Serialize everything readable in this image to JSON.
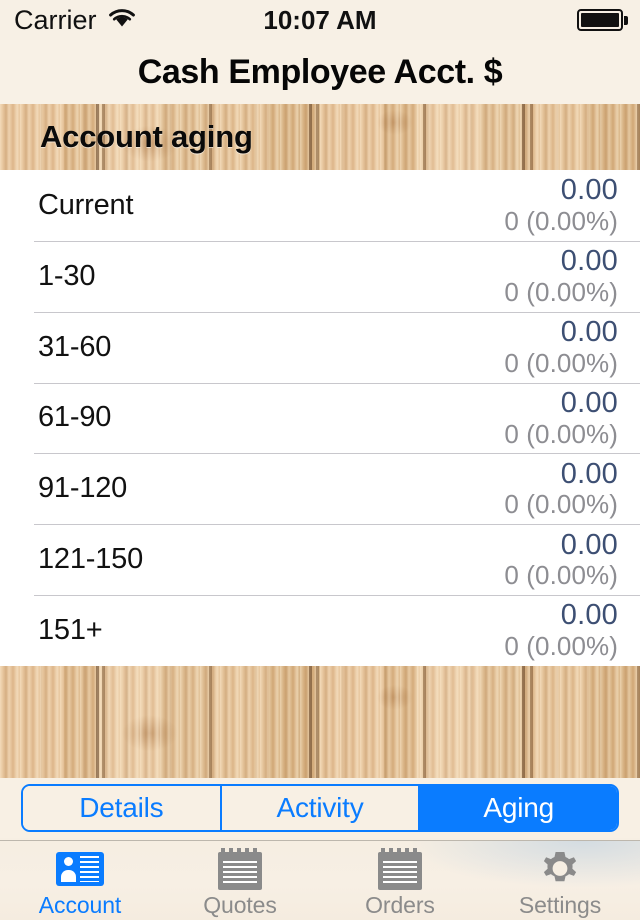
{
  "status_bar": {
    "carrier": "Carrier",
    "wifi_icon": "wifi-icon",
    "time": "10:07 AM",
    "battery_icon": "battery-full-icon"
  },
  "nav": {
    "title": "Cash Employee Acct. $"
  },
  "section": {
    "header": "Account aging"
  },
  "aging_rows": [
    {
      "label": "Current",
      "amount": "0.00",
      "detail": "0 (0.00%)"
    },
    {
      "label": "1-30",
      "amount": "0.00",
      "detail": "0 (0.00%)"
    },
    {
      "label": "31-60",
      "amount": "0.00",
      "detail": "0 (0.00%)"
    },
    {
      "label": "61-90",
      "amount": "0.00",
      "detail": "0 (0.00%)"
    },
    {
      "label": "91-120",
      "amount": "0.00",
      "detail": "0 (0.00%)"
    },
    {
      "label": "121-150",
      "amount": "0.00",
      "detail": "0 (0.00%)"
    },
    {
      "label": "151+",
      "amount": "0.00",
      "detail": "0 (0.00%)"
    }
  ],
  "segmented_control": {
    "segments": [
      {
        "label": "Details",
        "selected": false
      },
      {
        "label": "Activity",
        "selected": false
      },
      {
        "label": "Aging",
        "selected": true
      }
    ]
  },
  "tab_bar": {
    "tabs": [
      {
        "label": "Account",
        "icon": "id-card-icon",
        "active": true
      },
      {
        "label": "Quotes",
        "icon": "notepad-icon",
        "active": false
      },
      {
        "label": "Orders",
        "icon": "notepad-icon",
        "active": false
      },
      {
        "label": "Settings",
        "icon": "gear-icon",
        "active": false
      }
    ]
  },
  "colors": {
    "accent_blue": "#0a7cff",
    "amount_navy": "#3d4f73",
    "detail_gray": "#8d8d92",
    "chrome_cream": "#f8f0e4",
    "wood_tan": "#ddb787"
  }
}
